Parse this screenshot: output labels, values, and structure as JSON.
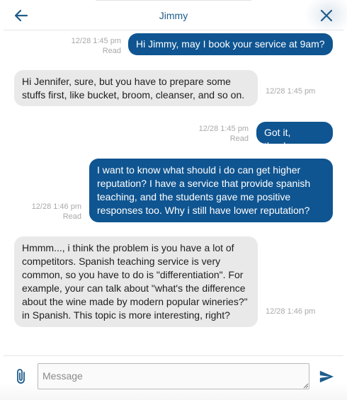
{
  "header": {
    "title": "Jimmy",
    "back_icon": "arrow-left-icon",
    "close_icon": "close-icon"
  },
  "colors": {
    "accent": "#1d5c8c",
    "outgoing_bubble": "#0f5591",
    "incoming_bubble": "#e9e9e9",
    "meta_text": "#a9a9a9"
  },
  "messages": [
    {
      "direction": "outgoing",
      "text": "Hi Jimmy, may I book your service at 9am?",
      "time": "12/28 1:45 pm",
      "status": "Read"
    },
    {
      "direction": "incoming",
      "text": "Hi Jennifer, sure, but you have to prepare some stuffs first, like bucket, broom, cleanser, and so on.",
      "time": "12/28 1:45 pm"
    },
    {
      "direction": "outgoing",
      "text": "Got it, thanks.",
      "time": "12/28 1:45 pm",
      "status": "Read"
    },
    {
      "direction": "outgoing",
      "text": "I want to know what should i do can get higher reputation? I have a service that provide spanish teaching, and the students gave me positive responses too. Why i still have lower reputation?",
      "time": "12/28 1:46 pm",
      "status": "Read"
    },
    {
      "direction": "incoming",
      "text": "Hmmm..., i think the problem is you have a lot of competitors. Spanish teaching service is very common, so you have to do is \"differentiation\". For example, your can talk about \"what's the difference about the wine made by modern popular wineries?\" in Spanish. This topic is more interesting, right?",
      "time": "12/28 1:46 pm"
    }
  ],
  "composer": {
    "placeholder": "Message",
    "value": "",
    "attach_icon": "paperclip-icon",
    "send_icon": "send-icon"
  }
}
